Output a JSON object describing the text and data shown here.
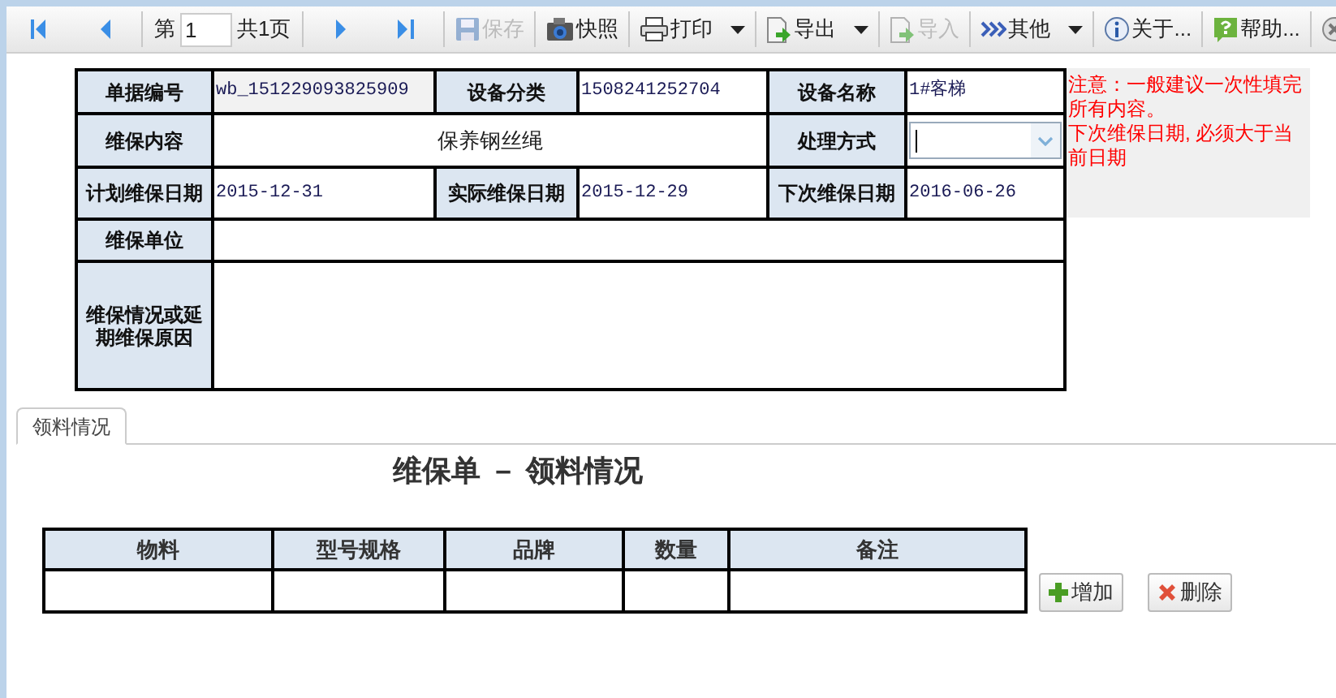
{
  "toolbar": {
    "items": [
      {
        "kind": "first",
        "disabled": false
      },
      {
        "kind": "prev",
        "disabled": false
      },
      {
        "kind": "pager",
        "prefix": "第",
        "value": "1",
        "suffix": "共1页"
      },
      {
        "kind": "next",
        "disabled": false
      },
      {
        "kind": "last",
        "disabled": false
      },
      {
        "kind": "save",
        "label": "保存",
        "disabled": true
      },
      {
        "kind": "snapshot",
        "label": "快照",
        "disabled": false
      },
      {
        "kind": "print",
        "label": "打印",
        "disabled": false,
        "dropdown": true
      },
      {
        "kind": "export",
        "label": "导出",
        "disabled": false,
        "dropdown": true
      },
      {
        "kind": "import",
        "label": "导入",
        "disabled": true
      },
      {
        "kind": "other",
        "label": "其他",
        "disabled": false,
        "dropdown": true
      },
      {
        "kind": "about",
        "label": "关于...",
        "disabled": false
      },
      {
        "kind": "help",
        "label": "帮助...",
        "disabled": false
      },
      {
        "kind": "close",
        "disabled": false
      }
    ]
  },
  "form": {
    "rows": [
      {
        "cells": [
          {
            "kind": "label",
            "text": "单据编号"
          },
          {
            "kind": "value",
            "text": "wb_151229093825909",
            "readonly": true
          },
          {
            "kind": "label",
            "text": "设备分类"
          },
          {
            "kind": "value",
            "text": "1508241252704",
            "readonly": false
          },
          {
            "kind": "label",
            "text": "设备名称"
          },
          {
            "kind": "value",
            "text": "1#客梯",
            "readonly": false
          }
        ]
      },
      {
        "cells": [
          {
            "kind": "label",
            "text": "维保内容"
          },
          {
            "kind": "value",
            "text": "保养钢丝绳",
            "readonly": false,
            "colspan": 3
          },
          {
            "kind": "label",
            "text": "处理方式"
          },
          {
            "kind": "select",
            "focused": true
          }
        ]
      },
      {
        "cells": [
          {
            "kind": "label",
            "text": "计划维保日期"
          },
          {
            "kind": "value",
            "text": "2015-12-31",
            "readonly": false
          },
          {
            "kind": "label",
            "text": "实际维保日期"
          },
          {
            "kind": "value",
            "text": "2015-12-29",
            "readonly": false
          },
          {
            "kind": "label",
            "text": "下次维保日期"
          },
          {
            "kind": "value",
            "text": "2016-06-26",
            "readonly": false
          }
        ]
      },
      {
        "cells": [
          {
            "kind": "label",
            "text": "维保单位"
          },
          {
            "kind": "value",
            "readonly": false,
            "colspan": 5
          }
        ]
      },
      {
        "cells": [
          {
            "kind": "label",
            "text": "维保情况或延期维保原因"
          },
          {
            "kind": "value",
            "readonly": false,
            "colspan": 5
          }
        ]
      }
    ],
    "notes": [
      "注意：一般建议一次性填完所有内容。",
      "下次维保日期, 必须大于当前日期"
    ]
  },
  "tabs": [
    {
      "label": "领料情况",
      "selected": true
    }
  ],
  "materials": {
    "title": "维保单 － 领料情况",
    "columns": [
      "物料",
      "型号规格",
      "品牌",
      "数量",
      "备注"
    ],
    "buttons": [
      {
        "kind": "add",
        "label": "增加"
      },
      {
        "kind": "delete",
        "label": "删除"
      }
    ]
  }
}
